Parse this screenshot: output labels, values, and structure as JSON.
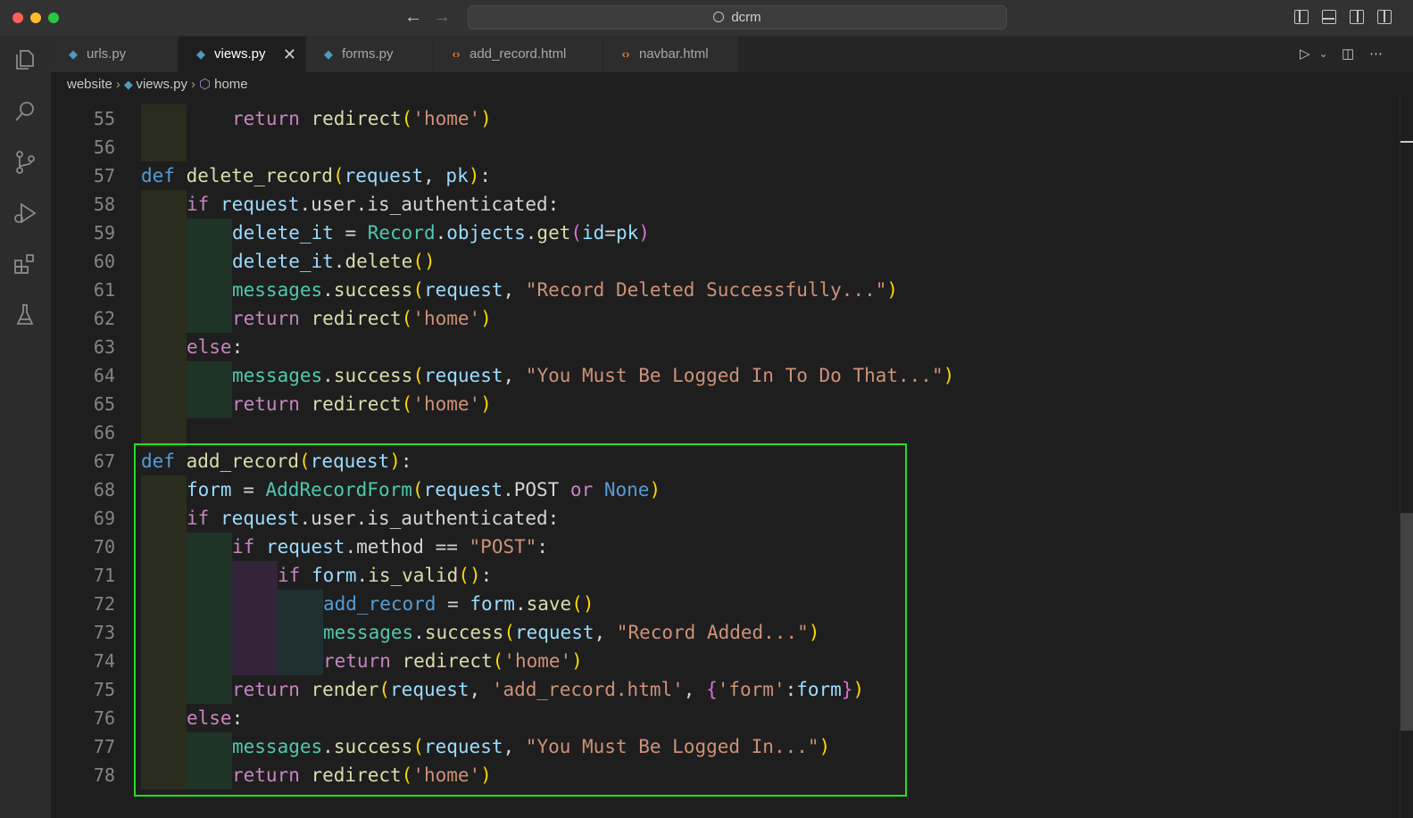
{
  "window": {
    "search_text": "dcrm"
  },
  "tabs": [
    {
      "label": "urls.py",
      "type": "py",
      "active": false
    },
    {
      "label": "views.py",
      "type": "py",
      "active": true,
      "close": "✕"
    },
    {
      "label": "forms.py",
      "type": "py",
      "active": false
    },
    {
      "label": "add_record.html",
      "type": "html",
      "active": false
    },
    {
      "label": "navbar.html",
      "type": "html",
      "active": false
    }
  ],
  "breadcrumb": {
    "folder": "website",
    "file": "views.py",
    "symbol": "home"
  },
  "line_numbers": [
    "55",
    "56",
    "57",
    "58",
    "59",
    "60",
    "61",
    "62",
    "63",
    "64",
    "65",
    "66",
    "67",
    "68",
    "69",
    "70",
    "71",
    "72",
    "73",
    "74",
    "75",
    "76",
    "77",
    "78"
  ],
  "code": {
    "l55": {
      "a": "return",
      "b": " redirect",
      "c": "(",
      "d": "'home'",
      "e": ")"
    },
    "l57": {
      "a": "def",
      "b": " delete_record",
      "c": "(",
      "d": "request",
      "e": ", ",
      "f": "pk",
      "g": ")",
      "h": ":"
    },
    "l58": {
      "a": "if",
      "b": " request",
      "c": ".user.is_authenticated:"
    },
    "l59": {
      "a": "delete_it",
      "b": " = ",
      "c": "Record",
      "d": ".",
      "e": "objects",
      "f": ".",
      "g": "get",
      "h": "(",
      "i": "id",
      "j": "=",
      "k": "pk",
      "l": ")"
    },
    "l60": {
      "a": "delete_it",
      "b": ".",
      "c": "delete",
      "d": "()"
    },
    "l61": {
      "a": "messages",
      "b": ".",
      "c": "success",
      "d": "(",
      "e": "request",
      "f": ", ",
      "g": "\"Record Deleted Successfully...\"",
      "h": ")"
    },
    "l62": {
      "a": "return",
      "b": " redirect",
      "c": "(",
      "d": "'home'",
      "e": ")"
    },
    "l63": {
      "a": "else",
      "b": ":"
    },
    "l64": {
      "a": "messages",
      "b": ".",
      "c": "success",
      "d": "(",
      "e": "request",
      "f": ", ",
      "g": "\"You Must Be Logged In To Do That...\"",
      "h": ")"
    },
    "l65": {
      "a": "return",
      "b": " redirect",
      "c": "(",
      "d": "'home'",
      "e": ")"
    },
    "l67": {
      "a": "def",
      "b": " add_record",
      "c": "(",
      "d": "request",
      "e": ")",
      "f": ":"
    },
    "l68": {
      "a": "form",
      "b": " = ",
      "c": "AddRecordForm",
      "d": "(",
      "e": "request",
      "f": ".POST ",
      "g": "or",
      "h": " None",
      "i": ")"
    },
    "l69": {
      "a": "if",
      "b": " request",
      "c": ".user.is_authenticated:"
    },
    "l70": {
      "a": "if",
      "b": " request",
      "c": ".method == ",
      "d": "\"POST\"",
      "e": ":"
    },
    "l71": {
      "a": "if",
      "b": " form",
      "c": ".",
      "d": "is_valid",
      "e": "()",
      "f": ":"
    },
    "l72": {
      "a": "add_record",
      "b": " = ",
      "c": "form",
      "d": ".",
      "e": "save",
      "f": "()"
    },
    "l73": {
      "a": "messages",
      "b": ".",
      "c": "success",
      "d": "(",
      "e": "request",
      "f": ", ",
      "g": "\"Record Added...\"",
      "h": ")"
    },
    "l74": {
      "a": "return",
      "b": " redirect",
      "c": "(",
      "d": "'home'",
      "e": ")"
    },
    "l75": {
      "a": "return",
      "b": " render",
      "c": "(",
      "d": "request",
      "e": ", ",
      "f": "'add_record.html'",
      "g": ", ",
      "h": "{",
      "i": "'form'",
      "j": ":",
      "k": "form",
      "l": "}",
      "m": ")"
    },
    "l76": {
      "a": "else",
      "b": ":"
    },
    "l77": {
      "a": "messages",
      "b": ".",
      "c": "success",
      "d": "(",
      "e": "request",
      "f": ", ",
      "g": "\"You Must Be Logged In...\"",
      "h": ")"
    },
    "l78": {
      "a": "return",
      "b": " redirect",
      "c": "(",
      "d": "'home'",
      "e": ")"
    }
  },
  "colors": {
    "keyword": "#c586c0",
    "def": "#569cd6",
    "function": "#dcdcaa",
    "variable": "#9cdcfe",
    "class": "#4ec9b0",
    "string": "#ce9178",
    "highlight_box": "#22dd22"
  },
  "icons": {
    "activity": [
      "explorer-icon",
      "search-icon",
      "source-control-icon",
      "run-debug-icon",
      "extensions-icon",
      "testing-icon"
    ]
  }
}
